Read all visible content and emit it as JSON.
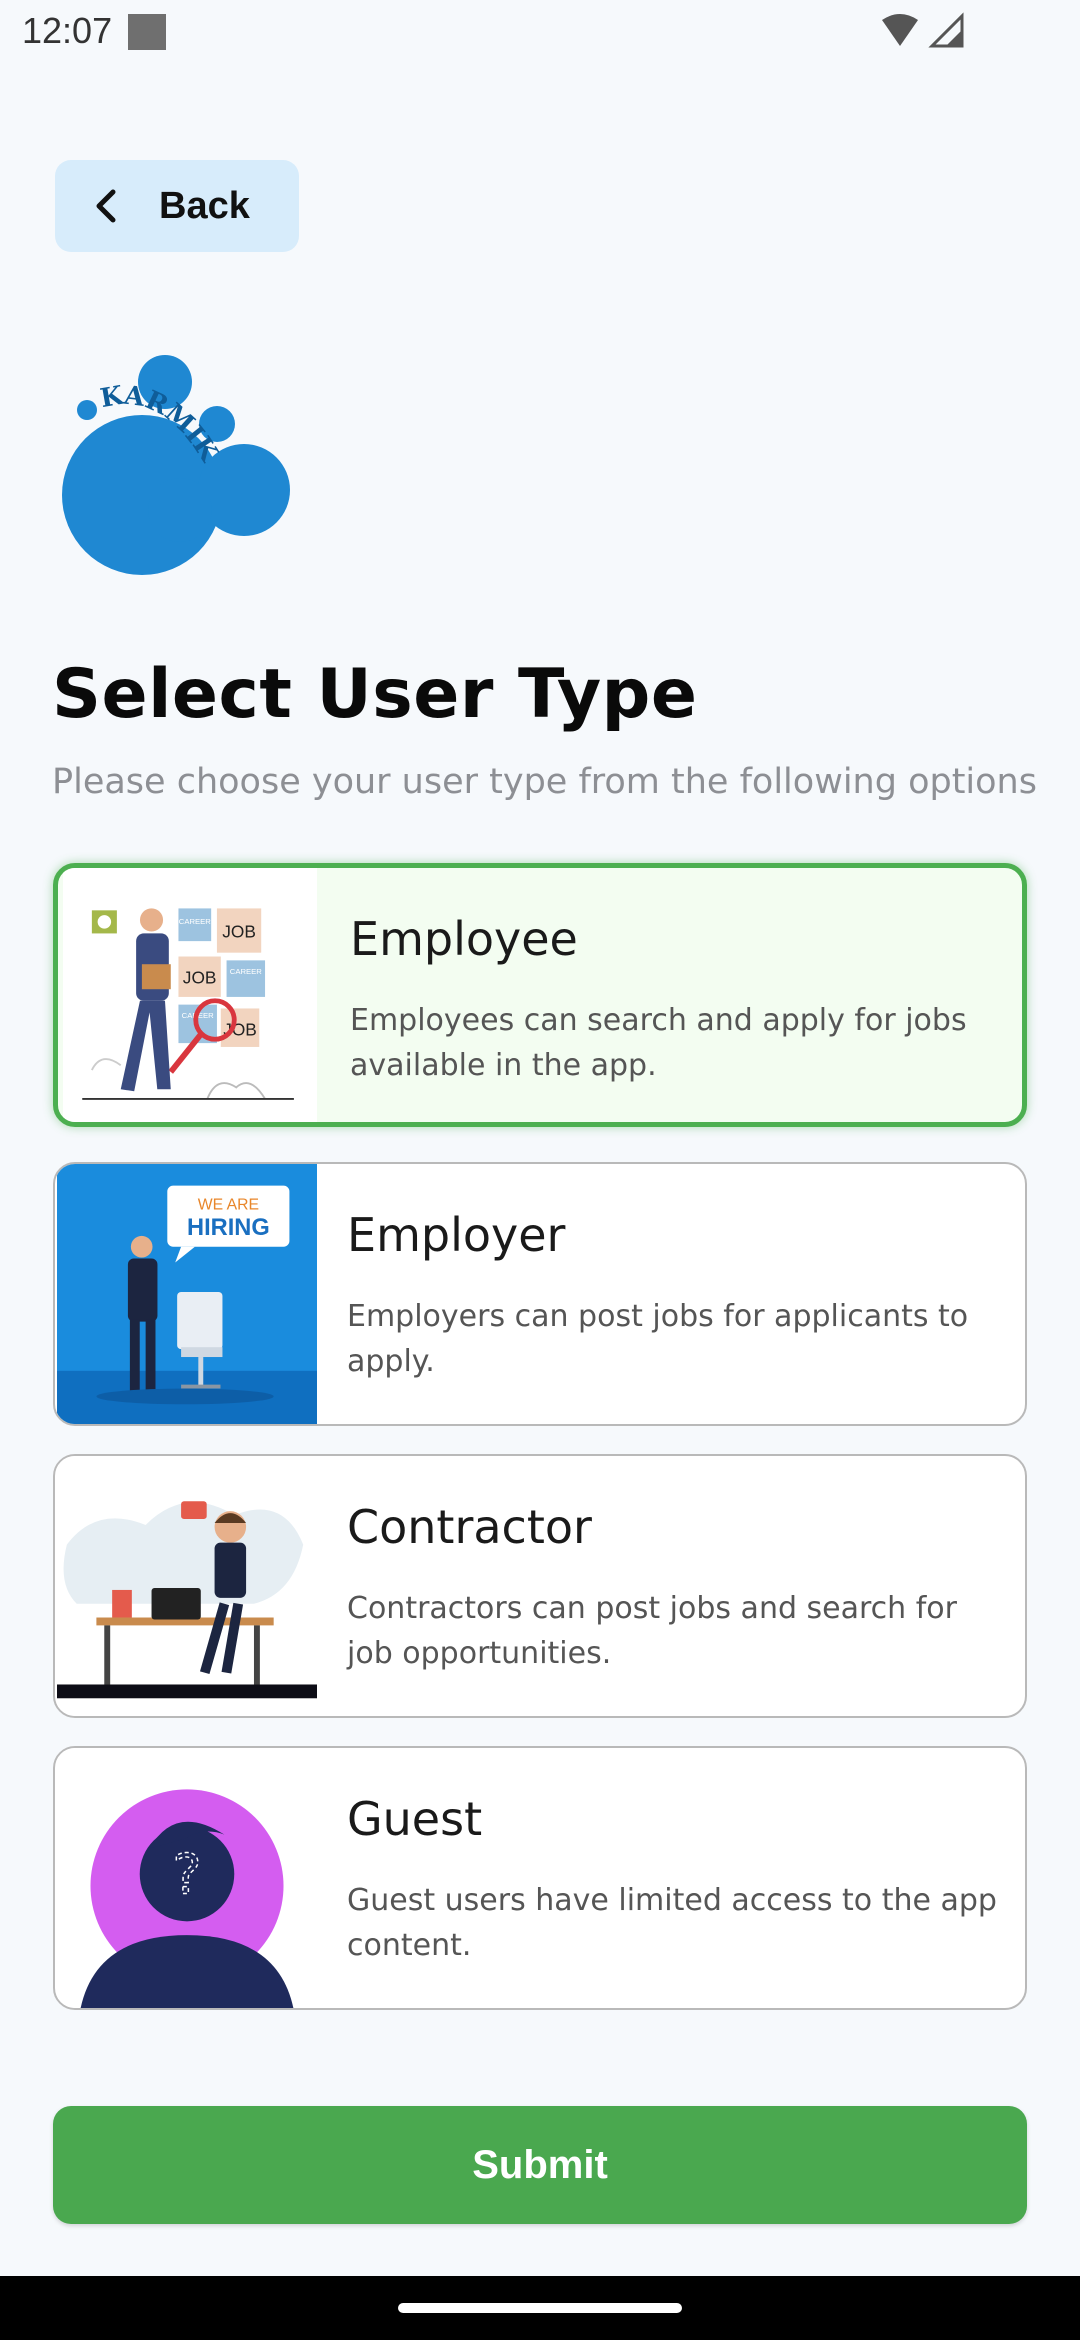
{
  "status": {
    "time": "12:07"
  },
  "header": {
    "back_label": "Back"
  },
  "logo": {
    "text": "KARMIK",
    "color": "#1f88d2"
  },
  "page": {
    "title": "Select User Type",
    "subtitle": "Please choose your user type from the following options"
  },
  "user_types": [
    {
      "title": "Employee",
      "description": "Employees can search and apply for jobs available in the app.",
      "selected": true
    },
    {
      "title": "Employer",
      "description": "Employers can post jobs for applicants to apply.",
      "selected": false
    },
    {
      "title": "Contractor",
      "description": "Contractors can post jobs and search for job opportunities.",
      "selected": false
    },
    {
      "title": "Guest",
      "description": "Guest users have limited access to the app content.",
      "selected": false
    }
  ],
  "illustrations": {
    "employee_signs": [
      "JOB",
      "JOB",
      "JOB",
      "CAREER",
      "CAREER",
      "CAREER"
    ],
    "employer_sign_top": "WE ARE",
    "employer_sign_bottom": "HIRING"
  },
  "footer": {
    "submit_label": "Submit"
  },
  "colors": {
    "accent_green": "#4caf50",
    "submit": "#4aa84f",
    "back_bg": "#d7ecfb",
    "selected_bg": "#f3fdf1"
  }
}
